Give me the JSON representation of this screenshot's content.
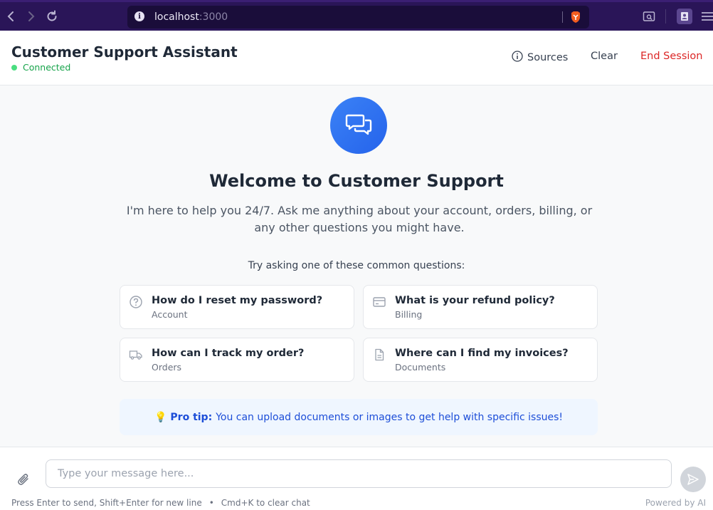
{
  "browser": {
    "url_host": "localhost",
    "url_port": ":3000"
  },
  "header": {
    "title": "Customer Support Assistant",
    "status": "Connected",
    "sources_label": "Sources",
    "clear_label": "Clear",
    "end_session_label": "End Session"
  },
  "welcome": {
    "title": "Welcome to Customer Support",
    "description": "I'm here to help you 24/7. Ask me anything about your account, orders, billing, or any other questions you might have.",
    "try_label": "Try asking one of these common questions:"
  },
  "questions": [
    {
      "title": "How do I reset my password?",
      "category": "Account",
      "icon": "question-circle-icon"
    },
    {
      "title": "What is your refund policy?",
      "category": "Billing",
      "icon": "credit-card-icon"
    },
    {
      "title": "How can I track my order?",
      "category": "Orders",
      "icon": "truck-icon"
    },
    {
      "title": "Where can I find my invoices?",
      "category": "Documents",
      "icon": "document-icon"
    }
  ],
  "pro_tip": {
    "bulb": "💡",
    "label": "Pro tip:",
    "text": "You can upload documents or images to get help with specific issues!"
  },
  "composer": {
    "placeholder": "Type your message here...",
    "hint_enter": "Press Enter to send, Shift+Enter for new line",
    "hint_sep": "•",
    "hint_clear": "Cmd+K to clear chat",
    "powered_by": "Powered by AI"
  },
  "colors": {
    "accent": "#2563eb",
    "danger": "#dc2626",
    "status_online": "#4ade80",
    "browser_bar": "#2a1558"
  }
}
